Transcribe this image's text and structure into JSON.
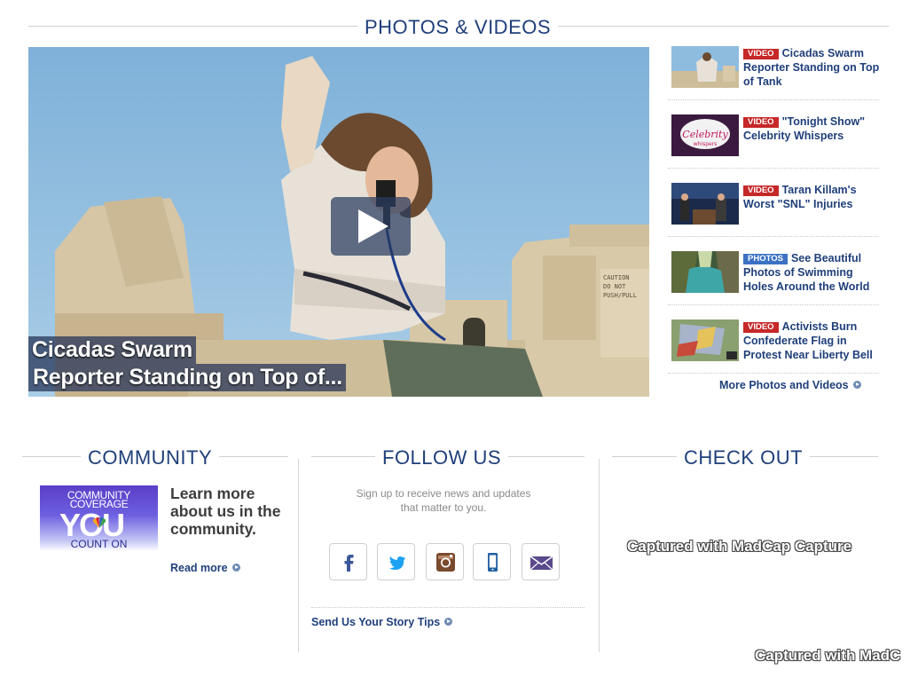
{
  "photos_videos": {
    "heading": "PHOTOS & VIDEOS",
    "hero": {
      "caption_line1": "Cicadas Swarm",
      "caption_line2": "Reporter Standing on Top of..."
    },
    "items": [
      {
        "tag": "VIDEO",
        "title": "Cicadas Swarm Reporter Standing on Top of Tank",
        "thumb": "reporter-on-tank"
      },
      {
        "tag": "VIDEO",
        "title": "\"Tonight Show\" Celebrity Whispers",
        "thumb": "celebrity-whispers"
      },
      {
        "tag": "VIDEO",
        "title": "Taran Killam's Worst \"SNL\" Injuries",
        "thumb": "late-night-set"
      },
      {
        "tag": "PHOTOS",
        "title": "See Beautiful Photos of Swimming Holes Around the World",
        "thumb": "swimming-hole"
      },
      {
        "tag": "VIDEO",
        "title": "Activists Burn Confederate Flag in Protest Near Liberty Bell",
        "thumb": "flag-protest"
      }
    ],
    "more_link": "More Photos and Videos"
  },
  "community": {
    "heading": "COMMUNITY",
    "logo": {
      "line1": "COMMUNITY",
      "line2": "COVERAGE",
      "line3": "YOU",
      "line4": "COUNT ON"
    },
    "text": "Learn more about us in the community.",
    "read_more": "Read more"
  },
  "follow_us": {
    "heading": "FOLLOW US",
    "text": "Sign up to receive news and updates that matter to you.",
    "social": [
      {
        "name": "facebook-icon",
        "color": "#3b5998"
      },
      {
        "name": "twitter-icon",
        "color": "#1da1f2"
      },
      {
        "name": "instagram-icon",
        "color": "#7a4a2e"
      },
      {
        "name": "mobile-icon",
        "color": "#1f5fa0"
      },
      {
        "name": "email-icon",
        "color": "#5a4a8c"
      }
    ],
    "story_tips": "Send Us Your Story Tips"
  },
  "check_out": {
    "heading": "CHECK OUT"
  },
  "watermarks": {
    "w1": "Captured with MadCap Capture",
    "w2": "Captured with MadC"
  },
  "colors": {
    "heading": "#1f3f7a",
    "video_tag": "#c62828",
    "photos_tag": "#3b72c4"
  }
}
